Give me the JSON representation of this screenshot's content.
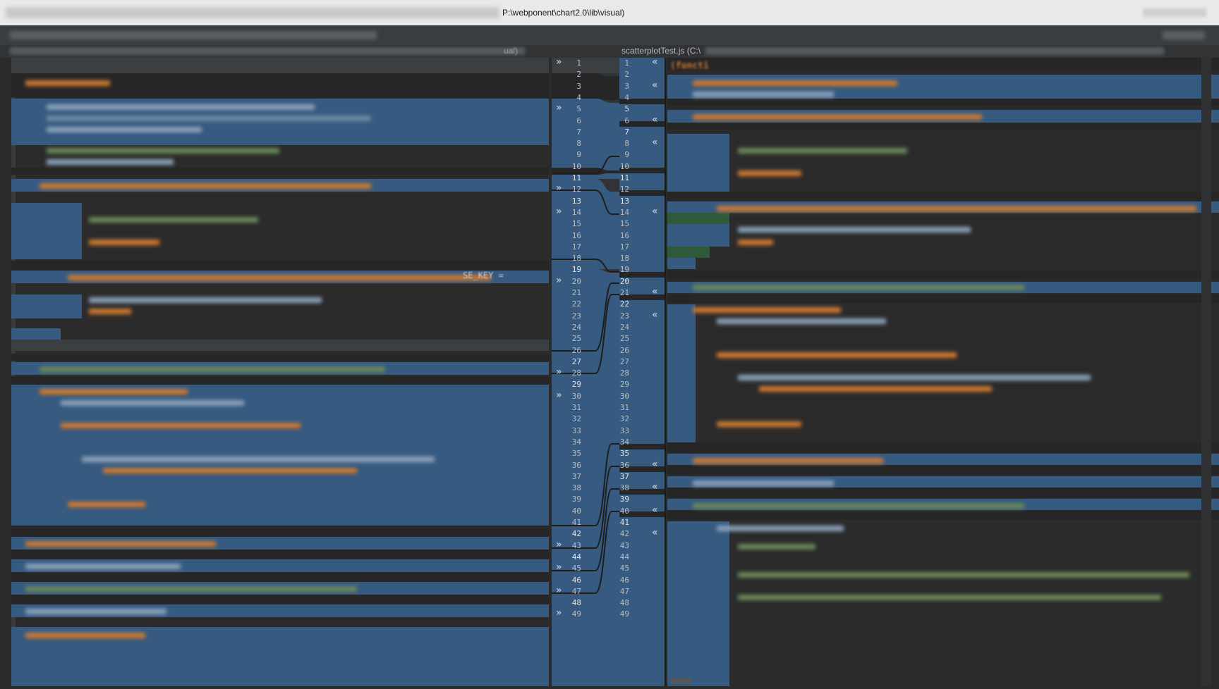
{
  "window": {
    "title_path": "P:\\webponent\\chart2.0\\lib\\visual)"
  },
  "header": {
    "left_suffix": "ual)",
    "right_file": "scatterplotTest.js (C:\\"
  },
  "editor": {
    "line_numbers": [
      1,
      2,
      3,
      4,
      5,
      6,
      7,
      8,
      9,
      10,
      11,
      12,
      13,
      14,
      15,
      16,
      17,
      18,
      19,
      20,
      21,
      22,
      23,
      24,
      25,
      26,
      27,
      28,
      29,
      30,
      31,
      32,
      33,
      34,
      35,
      36,
      37,
      38,
      39,
      40,
      41,
      42,
      43,
      44,
      45,
      46,
      47,
      48,
      49
    ],
    "left_bright_lines": [
      11,
      13,
      19,
      27,
      29,
      42,
      44,
      46,
      48
    ],
    "right_bright_lines": [
      5,
      7,
      11,
      13,
      20,
      22,
      35,
      37,
      39,
      41
    ],
    "right_first_token": "(functi",
    "left_fragment": "SE_KEY =",
    "arrow_right_glyph": "»",
    "arrow_left_glyph": "«",
    "left_arrow_lines": [
      1,
      5,
      12,
      14,
      20,
      28,
      30,
      43,
      45,
      47,
      49
    ],
    "right_arrow_lines": [
      1,
      3,
      6,
      8,
      14,
      21,
      23,
      36,
      38,
      40,
      42
    ]
  },
  "colors": {
    "background": "#2b2b2b",
    "diff_blue": "#365a80",
    "gutter": "#313335",
    "keyword_orange": "#cc7832"
  }
}
